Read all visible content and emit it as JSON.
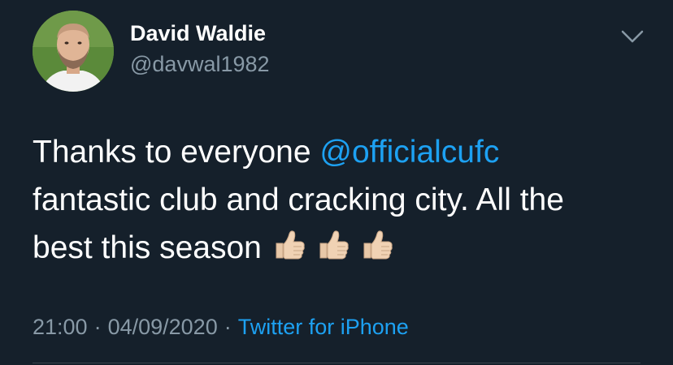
{
  "author": {
    "display_name": "David Waldie",
    "handle": "@davwal1982",
    "avatar_icon": "profile-photo"
  },
  "menu_icon": "chevron-down-icon",
  "tweet": {
    "line1_text": "Thanks to everyone ",
    "mention": "@officialcufc",
    "line2_text": "fantastic club and cracking city. All the",
    "line3_text": "best this season",
    "emojis": [
      "👍🏼",
      "👍🏼",
      "👍🏼"
    ]
  },
  "meta": {
    "time": "21:00",
    "separator": "·",
    "date": "04/09/2020",
    "source": "Twitter for iPhone"
  },
  "colors": {
    "background": "#15202b",
    "primary_text": "#ffffff",
    "secondary_text": "#8899a6",
    "link": "#1da1f2",
    "divider": "#38444d"
  }
}
